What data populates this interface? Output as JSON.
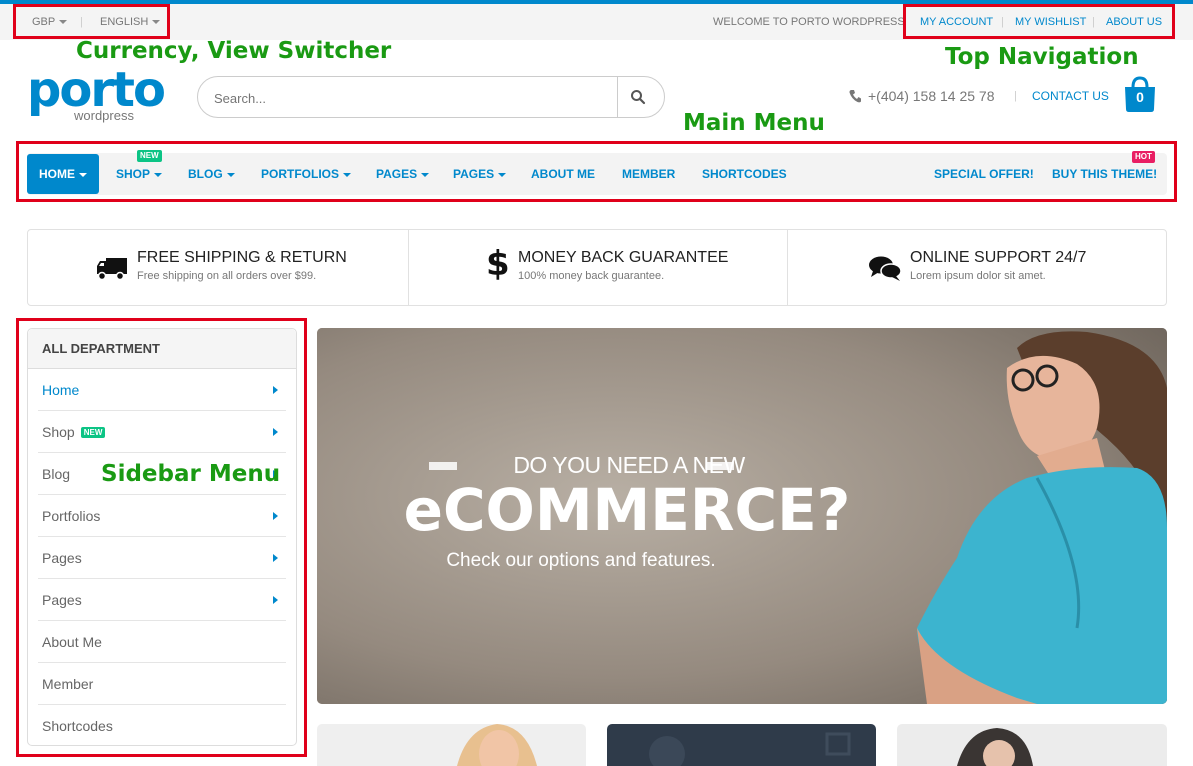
{
  "topbar": {
    "currency": "GBP",
    "language": "ENGLISH",
    "welcome": "WELCOME TO PORTO WORDPRESS",
    "links": [
      "MY ACCOUNT",
      "MY WISHLIST",
      "ABOUT US"
    ]
  },
  "annotations": {
    "currency_switcher": "Currency, View Switcher",
    "top_navigation": "Top Navigation",
    "main_menu": "Main Menu",
    "sidebar_menu": "Sidebar Menu"
  },
  "header": {
    "logo": "porto",
    "logo_sub": "wordpress",
    "search_placeholder": "Search...",
    "phone": "+(404) 158 14 25 78",
    "contact": "CONTACT US",
    "cart_count": "0"
  },
  "menu": {
    "items": [
      {
        "label": "HOME"
      },
      {
        "label": "SHOP",
        "badge": "NEW"
      },
      {
        "label": "BLOG"
      },
      {
        "label": "PORTFOLIOS"
      },
      {
        "label": "PAGES"
      },
      {
        "label": "PAGES"
      },
      {
        "label": "ABOUT ME"
      },
      {
        "label": "MEMBER"
      },
      {
        "label": "SHORTCODES"
      }
    ],
    "right": [
      {
        "label": "SPECIAL OFFER!"
      },
      {
        "label": "BUY THIS THEME!",
        "badge": "HOT"
      }
    ]
  },
  "features": [
    {
      "title": "FREE SHIPPING & RETURN",
      "sub": "Free shipping on all orders over $99.",
      "icon": "truck-icon"
    },
    {
      "title": "MONEY BACK GUARANTEE",
      "sub": "100% money back guarantee.",
      "icon": "dollar-icon"
    },
    {
      "title": "ONLINE SUPPORT 24/7",
      "sub": "Lorem ipsum dolor sit amet.",
      "icon": "chat-icon"
    }
  ],
  "sidebar": {
    "title": "ALL DEPARTMENT",
    "items": [
      {
        "label": "Home"
      },
      {
        "label": "Shop",
        "badge": "NEW"
      },
      {
        "label": "Blog"
      },
      {
        "label": "Portfolios"
      },
      {
        "label": "Pages"
      },
      {
        "label": "Pages"
      },
      {
        "label": "About Me"
      },
      {
        "label": "Member"
      },
      {
        "label": "Shortcodes"
      }
    ]
  },
  "hero": {
    "line1": "DO YOU NEED A NEW",
    "line2": "eCOMMERCE?",
    "line3": "Check our options and features."
  },
  "colors": {
    "accent": "#0088cc",
    "annotation": "#1a9a13",
    "highlight_box": "#e0001a",
    "badge_new": "#0cc485",
    "badge_hot": "#e91e63"
  }
}
